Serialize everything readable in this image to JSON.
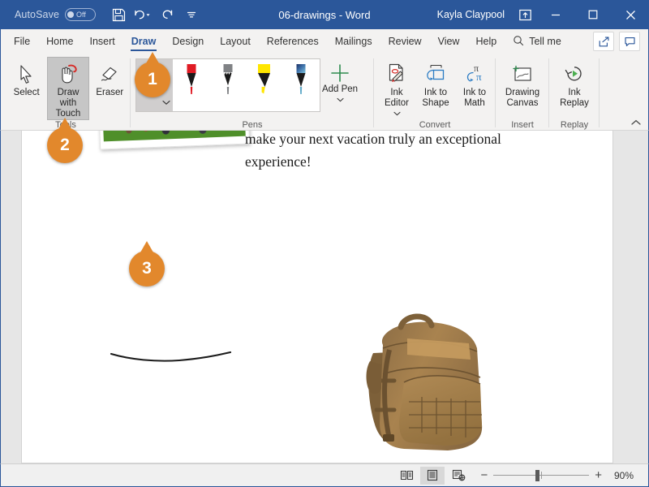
{
  "titlebar": {
    "autosave_label": "AutoSave",
    "autosave_state": "Off",
    "document_title": "06-drawings - Word",
    "account_name": "Kayla Claypool",
    "quick_access": [
      {
        "name": "save-icon",
        "tooltip": "Save"
      },
      {
        "name": "undo-icon",
        "tooltip": "Undo"
      },
      {
        "name": "redo-icon",
        "tooltip": "Redo"
      },
      {
        "name": "customize-quick-access-toolbar-icon",
        "tooltip": "Customize Quick Access Toolbar"
      }
    ],
    "window_controls": [
      {
        "name": "ribbon-display-options-icon",
        "label": "Ribbon Display Options"
      },
      {
        "name": "minimize-icon",
        "label": "Minimize"
      },
      {
        "name": "maximize-icon",
        "label": "Maximize"
      },
      {
        "name": "close-icon",
        "label": "Close"
      }
    ],
    "accent_color": "#2b579a"
  },
  "tabs": [
    {
      "label": "File",
      "active": false
    },
    {
      "label": "Home",
      "active": false
    },
    {
      "label": "Insert",
      "active": false
    },
    {
      "label": "Draw",
      "active": true
    },
    {
      "label": "Design",
      "active": false
    },
    {
      "label": "Layout",
      "active": false
    },
    {
      "label": "References",
      "active": false
    },
    {
      "label": "Mailings",
      "active": false
    },
    {
      "label": "Review",
      "active": false
    },
    {
      "label": "View",
      "active": false
    },
    {
      "label": "Help",
      "active": false
    }
  ],
  "tellme": {
    "label": "Tell me",
    "icon": "search-icon"
  },
  "tabstrip_buttons": [
    {
      "name": "share-button",
      "label": "Share"
    },
    {
      "name": "comments-button",
      "label": "Comments"
    }
  ],
  "ribbon": {
    "collapse_label": "Collapse the Ribbon",
    "groups": [
      {
        "name": "tools",
        "label": "Tools",
        "buttons": [
          {
            "label": "Select",
            "icon": "cursor-arrow-icon",
            "selected": false
          },
          {
            "label": "Draw with Touch",
            "icon": "hand-draw-icon",
            "selected": true
          },
          {
            "label": "Eraser",
            "icon": "eraser-icon",
            "selected": false
          }
        ]
      },
      {
        "name": "pens",
        "label": "Pens",
        "pens": [
          {
            "label": "Pen: Black",
            "color": "#1a1a1a",
            "type": "pen",
            "selected": true
          },
          {
            "label": "Pen: Red",
            "color": "#e01b24",
            "type": "pen",
            "selected": false
          },
          {
            "label": "Pencil: Gray",
            "color": "#808285",
            "type": "pencil",
            "selected": false
          },
          {
            "label": "Highlighter: Yellow",
            "color": "#ffe600",
            "type": "highlighter",
            "selected": false
          },
          {
            "label": "Pen: Galaxy",
            "color": "#2f6fa8",
            "type": "effect-pen",
            "selected": false
          }
        ],
        "add_pen": {
          "label": "Add Pen",
          "icon": "plus-icon",
          "has_dropdown": true
        }
      },
      {
        "name": "convert",
        "label": "Convert",
        "buttons": [
          {
            "label": "Ink Editor",
            "icon": "ink-editor-icon",
            "has_dropdown": true
          },
          {
            "label": "Ink to Shape",
            "icon": "ink-to-shape-icon",
            "has_dropdown": false
          },
          {
            "label": "Ink to Math",
            "icon": "ink-to-math-icon",
            "has_dropdown": false
          }
        ]
      },
      {
        "name": "insert",
        "label": "Insert",
        "buttons": [
          {
            "label": "Drawing Canvas",
            "icon": "drawing-canvas-icon",
            "has_dropdown": false
          }
        ]
      },
      {
        "name": "replay",
        "label": "Replay",
        "buttons": [
          {
            "label": "Ink Replay",
            "icon": "ink-replay-icon",
            "has_dropdown": false
          }
        ]
      }
    ]
  },
  "document": {
    "paragraph_line_1": "make your next vacation truly an exceptional",
    "paragraph_line_2": "experience!",
    "photo_alt": "tilted photo of people on a green field",
    "backpack_alt": "tan tactical backpack product image",
    "ink_stroke_alt": "hand drawn black ink curve"
  },
  "statusbar": {
    "views": [
      {
        "name": "read-mode-icon",
        "label": "Read Mode",
        "active": false
      },
      {
        "name": "print-layout-icon",
        "label": "Print Layout",
        "active": true
      },
      {
        "name": "web-layout-icon",
        "label": "Web Layout",
        "active": false
      }
    ],
    "zoom_out_label": "−",
    "zoom_in_label": "+",
    "zoom_level": "90%"
  },
  "callouts": [
    {
      "number": "1",
      "target": "pens-gallery-first-pen"
    },
    {
      "number": "2",
      "target": "tools-group-draw-with-touch"
    },
    {
      "number": "3",
      "target": "document-ink-stroke"
    }
  ]
}
